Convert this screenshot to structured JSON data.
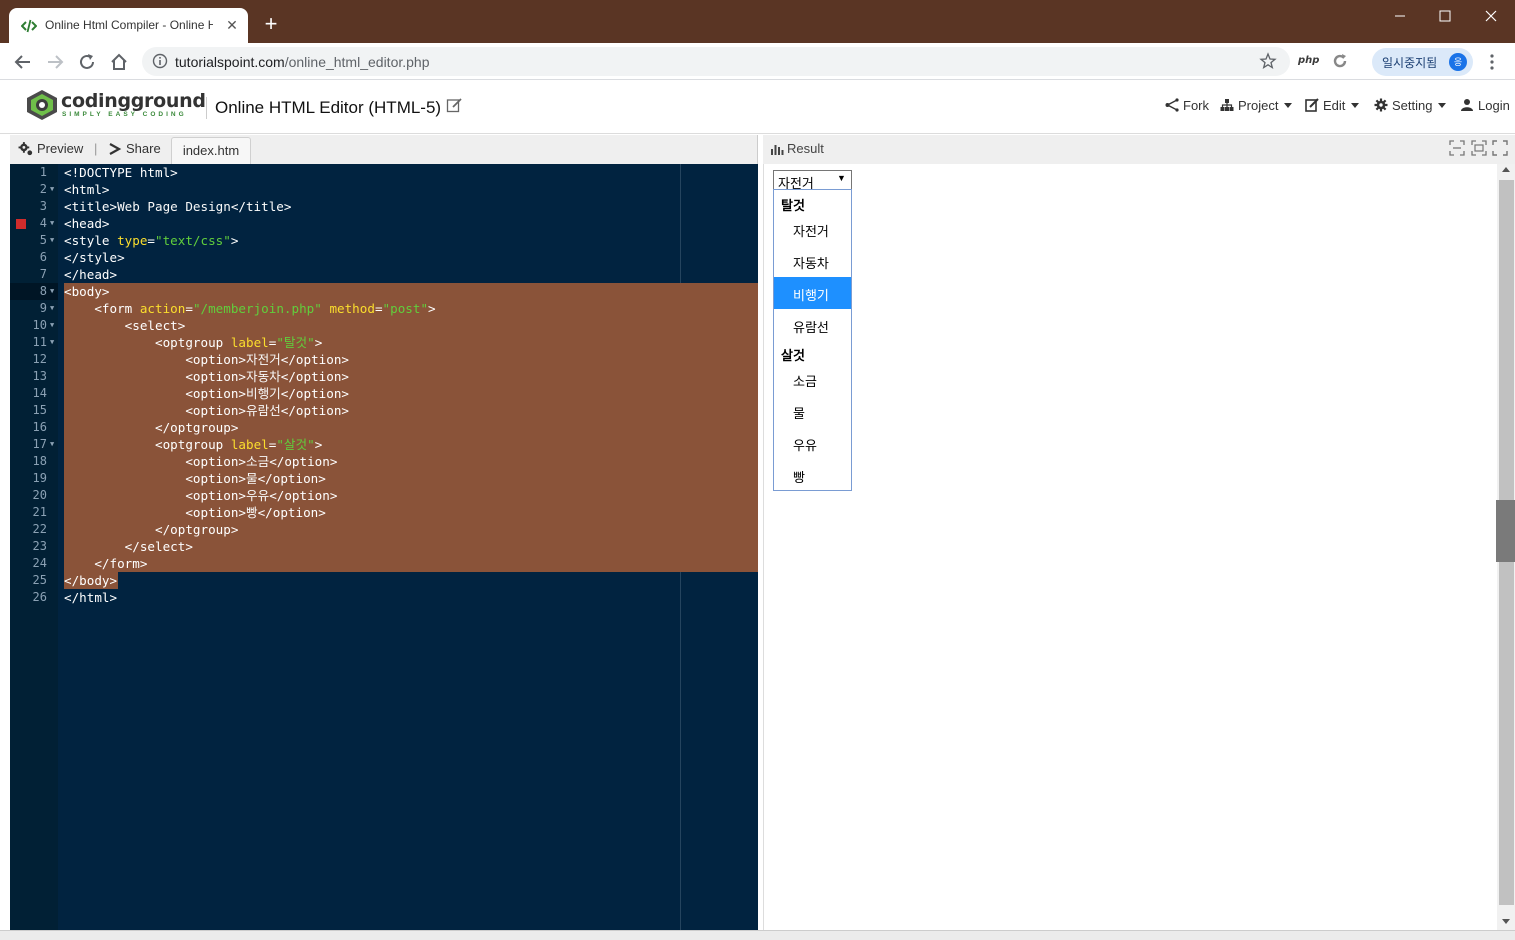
{
  "browser": {
    "tab_title": "Online Html Compiler - Online H",
    "url_domain": "tutorialspoint.com",
    "url_path": "/online_html_editor.php",
    "php_ext": "php",
    "profile_label": "일시중지됨",
    "profile_initial": "응"
  },
  "site": {
    "logo_word": "codingground",
    "logo_tagline": "SIMPLY EASY CODING",
    "title": "Online HTML Editor (HTML-5)",
    "menu": {
      "fork": "Fork",
      "project": "Project",
      "edit": "Edit",
      "setting": "Setting",
      "login": "Login"
    }
  },
  "editor": {
    "toolbar": {
      "preview": "Preview",
      "separator": "|",
      "share": "Share",
      "file_tab": "index.htm"
    },
    "lines": [
      {
        "n": "1",
        "fold": false,
        "error": false,
        "parts": [
          [
            "tag",
            "<!DOCTYPE html>"
          ]
        ]
      },
      {
        "n": "2",
        "fold": true,
        "error": false,
        "parts": [
          [
            "tag",
            "<html>"
          ]
        ]
      },
      {
        "n": "3",
        "fold": false,
        "error": false,
        "parts": [
          [
            "tag",
            "<title>"
          ],
          [
            "txt",
            "Web Page Design"
          ],
          [
            "tag",
            "</title>"
          ]
        ]
      },
      {
        "n": "4",
        "fold": true,
        "error": true,
        "parts": [
          [
            "tag",
            "<head>"
          ]
        ]
      },
      {
        "n": "5",
        "fold": true,
        "error": false,
        "parts": [
          [
            "tag",
            "<style "
          ],
          [
            "attr",
            "type"
          ],
          [
            "tag",
            "="
          ],
          [
            "str",
            "\"text/css\""
          ],
          [
            "tag",
            ">"
          ]
        ]
      },
      {
        "n": "6",
        "fold": false,
        "error": false,
        "parts": [
          [
            "tag",
            "</style>"
          ]
        ]
      },
      {
        "n": "7",
        "fold": false,
        "error": false,
        "parts": [
          [
            "tag",
            "</head>"
          ]
        ]
      },
      {
        "n": "8",
        "fold": true,
        "error": false,
        "parts": [
          [
            "tag",
            "<body>"
          ]
        ]
      },
      {
        "n": "9",
        "fold": true,
        "error": false,
        "parts": [
          [
            "indent",
            "    "
          ],
          [
            "tag",
            "<form "
          ],
          [
            "attr",
            "action"
          ],
          [
            "tag",
            "="
          ],
          [
            "str",
            "\"/memberjoin.php\""
          ],
          [
            "tag",
            " "
          ],
          [
            "attr",
            "method"
          ],
          [
            "tag",
            "="
          ],
          [
            "str",
            "\"post\""
          ],
          [
            "tag",
            ">"
          ]
        ]
      },
      {
        "n": "10",
        "fold": true,
        "error": false,
        "parts": [
          [
            "indent",
            "        "
          ],
          [
            "tag",
            "<select>"
          ]
        ]
      },
      {
        "n": "11",
        "fold": true,
        "error": false,
        "parts": [
          [
            "indent",
            "            "
          ],
          [
            "tag",
            "<optgroup "
          ],
          [
            "attr",
            "label"
          ],
          [
            "tag",
            "="
          ],
          [
            "str",
            "\"탈것\""
          ],
          [
            "tag",
            ">"
          ]
        ]
      },
      {
        "n": "12",
        "fold": false,
        "error": false,
        "parts": [
          [
            "indent",
            "                "
          ],
          [
            "tag",
            "<option>"
          ],
          [
            "txt",
            "자전거"
          ],
          [
            "tag",
            "</option>"
          ]
        ]
      },
      {
        "n": "13",
        "fold": false,
        "error": false,
        "parts": [
          [
            "indent",
            "                "
          ],
          [
            "tag",
            "<option>"
          ],
          [
            "txt",
            "자동차"
          ],
          [
            "tag",
            "</option>"
          ]
        ]
      },
      {
        "n": "14",
        "fold": false,
        "error": false,
        "parts": [
          [
            "indent",
            "                "
          ],
          [
            "tag",
            "<option>"
          ],
          [
            "txt",
            "비행기"
          ],
          [
            "tag",
            "</option>"
          ]
        ]
      },
      {
        "n": "15",
        "fold": false,
        "error": false,
        "parts": [
          [
            "indent",
            "                "
          ],
          [
            "tag",
            "<option>"
          ],
          [
            "txt",
            "유람선"
          ],
          [
            "tag",
            "</option>"
          ]
        ]
      },
      {
        "n": "16",
        "fold": false,
        "error": false,
        "parts": [
          [
            "indent",
            "            "
          ],
          [
            "tag",
            "</optgroup>"
          ]
        ]
      },
      {
        "n": "17",
        "fold": true,
        "error": false,
        "parts": [
          [
            "indent",
            "            "
          ],
          [
            "tag",
            "<optgroup "
          ],
          [
            "attr",
            "label"
          ],
          [
            "tag",
            "="
          ],
          [
            "str",
            "\"살것\""
          ],
          [
            "tag",
            ">"
          ]
        ]
      },
      {
        "n": "18",
        "fold": false,
        "error": false,
        "parts": [
          [
            "indent",
            "                "
          ],
          [
            "tag",
            "<option>"
          ],
          [
            "txt",
            "소금"
          ],
          [
            "tag",
            "</option>"
          ]
        ]
      },
      {
        "n": "19",
        "fold": false,
        "error": false,
        "parts": [
          [
            "indent",
            "                "
          ],
          [
            "tag",
            "<option>"
          ],
          [
            "txt",
            "물"
          ],
          [
            "tag",
            "</option>"
          ]
        ]
      },
      {
        "n": "20",
        "fold": false,
        "error": false,
        "parts": [
          [
            "indent",
            "                "
          ],
          [
            "tag",
            "<option>"
          ],
          [
            "txt",
            "우유"
          ],
          [
            "tag",
            "</option>"
          ]
        ]
      },
      {
        "n": "21",
        "fold": false,
        "error": false,
        "parts": [
          [
            "indent",
            "                "
          ],
          [
            "tag",
            "<option>"
          ],
          [
            "txt",
            "빵"
          ],
          [
            "tag",
            "</option>"
          ]
        ]
      },
      {
        "n": "22",
        "fold": false,
        "error": false,
        "parts": [
          [
            "indent",
            "            "
          ],
          [
            "tag",
            "</optgroup>"
          ]
        ]
      },
      {
        "n": "23",
        "fold": false,
        "error": false,
        "parts": [
          [
            "indent",
            "        "
          ],
          [
            "tag",
            "</select>"
          ]
        ]
      },
      {
        "n": "24",
        "fold": false,
        "error": false,
        "parts": [
          [
            "indent",
            "    "
          ],
          [
            "tag",
            "</form>"
          ]
        ]
      },
      {
        "n": "25",
        "fold": false,
        "error": false,
        "parts": [
          [
            "tag",
            "</body>"
          ]
        ]
      },
      {
        "n": "26",
        "fold": false,
        "error": false,
        "parts": [
          [
            "tag",
            "</html>"
          ]
        ]
      }
    ]
  },
  "result": {
    "label": "Result",
    "select_value": "자전거",
    "select_arrow": "▼",
    "groups": [
      {
        "label": "탈것",
        "options": [
          "자전거",
          "자동차",
          "비행기",
          "유람선"
        ]
      },
      {
        "label": "살것",
        "options": [
          "소금",
          "물",
          "우유",
          "빵"
        ]
      }
    ],
    "highlighted_option": "비행기"
  },
  "colors": {
    "editor_bg": "#012340",
    "selection": "#8a5339",
    "tag": "#ffffff",
    "attr": "#fbde2d",
    "string": "#61ce3c",
    "highlight": "#1e90ff",
    "titlebar": "#5a3524"
  },
  "icons": [
    "code-favicon-icon",
    "close-icon",
    "plus-icon",
    "back-icon",
    "forward-icon",
    "reload-icon",
    "home-icon",
    "info-icon",
    "star-icon",
    "refresh-ext-icon",
    "menu-dots-icon",
    "edit-pencil-icon",
    "fork-icon",
    "project-icon",
    "edit-icon",
    "gear-icon",
    "user-icon",
    "preview-gear-icon",
    "share-icon",
    "bar-chart-icon",
    "fullscreen-icon"
  ]
}
